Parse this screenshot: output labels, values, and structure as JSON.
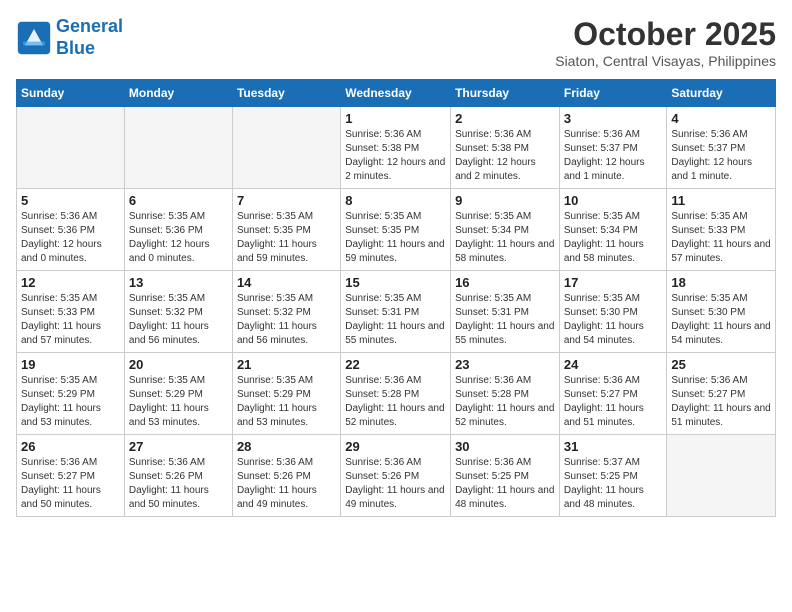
{
  "header": {
    "logo_line1": "General",
    "logo_line2": "Blue",
    "month": "October 2025",
    "location": "Siaton, Central Visayas, Philippines"
  },
  "days_of_week": [
    "Sunday",
    "Monday",
    "Tuesday",
    "Wednesday",
    "Thursday",
    "Friday",
    "Saturday"
  ],
  "weeks": [
    [
      {
        "day": "",
        "empty": true
      },
      {
        "day": "",
        "empty": true
      },
      {
        "day": "",
        "empty": true
      },
      {
        "day": "1",
        "sunrise": "5:36 AM",
        "sunset": "5:38 PM",
        "daylight": "12 hours and 2 minutes."
      },
      {
        "day": "2",
        "sunrise": "5:36 AM",
        "sunset": "5:38 PM",
        "daylight": "12 hours and 2 minutes."
      },
      {
        "day": "3",
        "sunrise": "5:36 AM",
        "sunset": "5:37 PM",
        "daylight": "12 hours and 1 minute."
      },
      {
        "day": "4",
        "sunrise": "5:36 AM",
        "sunset": "5:37 PM",
        "daylight": "12 hours and 1 minute."
      }
    ],
    [
      {
        "day": "5",
        "sunrise": "5:36 AM",
        "sunset": "5:36 PM",
        "daylight": "12 hours and 0 minutes."
      },
      {
        "day": "6",
        "sunrise": "5:35 AM",
        "sunset": "5:36 PM",
        "daylight": "12 hours and 0 minutes."
      },
      {
        "day": "7",
        "sunrise": "5:35 AM",
        "sunset": "5:35 PM",
        "daylight": "11 hours and 59 minutes."
      },
      {
        "day": "8",
        "sunrise": "5:35 AM",
        "sunset": "5:35 PM",
        "daylight": "11 hours and 59 minutes."
      },
      {
        "day": "9",
        "sunrise": "5:35 AM",
        "sunset": "5:34 PM",
        "daylight": "11 hours and 58 minutes."
      },
      {
        "day": "10",
        "sunrise": "5:35 AM",
        "sunset": "5:34 PM",
        "daylight": "11 hours and 58 minutes."
      },
      {
        "day": "11",
        "sunrise": "5:35 AM",
        "sunset": "5:33 PM",
        "daylight": "11 hours and 57 minutes."
      }
    ],
    [
      {
        "day": "12",
        "sunrise": "5:35 AM",
        "sunset": "5:33 PM",
        "daylight": "11 hours and 57 minutes."
      },
      {
        "day": "13",
        "sunrise": "5:35 AM",
        "sunset": "5:32 PM",
        "daylight": "11 hours and 56 minutes."
      },
      {
        "day": "14",
        "sunrise": "5:35 AM",
        "sunset": "5:32 PM",
        "daylight": "11 hours and 56 minutes."
      },
      {
        "day": "15",
        "sunrise": "5:35 AM",
        "sunset": "5:31 PM",
        "daylight": "11 hours and 55 minutes."
      },
      {
        "day": "16",
        "sunrise": "5:35 AM",
        "sunset": "5:31 PM",
        "daylight": "11 hours and 55 minutes."
      },
      {
        "day": "17",
        "sunrise": "5:35 AM",
        "sunset": "5:30 PM",
        "daylight": "11 hours and 54 minutes."
      },
      {
        "day": "18",
        "sunrise": "5:35 AM",
        "sunset": "5:30 PM",
        "daylight": "11 hours and 54 minutes."
      }
    ],
    [
      {
        "day": "19",
        "sunrise": "5:35 AM",
        "sunset": "5:29 PM",
        "daylight": "11 hours and 53 minutes."
      },
      {
        "day": "20",
        "sunrise": "5:35 AM",
        "sunset": "5:29 PM",
        "daylight": "11 hours and 53 minutes."
      },
      {
        "day": "21",
        "sunrise": "5:35 AM",
        "sunset": "5:29 PM",
        "daylight": "11 hours and 53 minutes."
      },
      {
        "day": "22",
        "sunrise": "5:36 AM",
        "sunset": "5:28 PM",
        "daylight": "11 hours and 52 minutes."
      },
      {
        "day": "23",
        "sunrise": "5:36 AM",
        "sunset": "5:28 PM",
        "daylight": "11 hours and 52 minutes."
      },
      {
        "day": "24",
        "sunrise": "5:36 AM",
        "sunset": "5:27 PM",
        "daylight": "11 hours and 51 minutes."
      },
      {
        "day": "25",
        "sunrise": "5:36 AM",
        "sunset": "5:27 PM",
        "daylight": "11 hours and 51 minutes."
      }
    ],
    [
      {
        "day": "26",
        "sunrise": "5:36 AM",
        "sunset": "5:27 PM",
        "daylight": "11 hours and 50 minutes."
      },
      {
        "day": "27",
        "sunrise": "5:36 AM",
        "sunset": "5:26 PM",
        "daylight": "11 hours and 50 minutes."
      },
      {
        "day": "28",
        "sunrise": "5:36 AM",
        "sunset": "5:26 PM",
        "daylight": "11 hours and 49 minutes."
      },
      {
        "day": "29",
        "sunrise": "5:36 AM",
        "sunset": "5:26 PM",
        "daylight": "11 hours and 49 minutes."
      },
      {
        "day": "30",
        "sunrise": "5:36 AM",
        "sunset": "5:25 PM",
        "daylight": "11 hours and 48 minutes."
      },
      {
        "day": "31",
        "sunrise": "5:37 AM",
        "sunset": "5:25 PM",
        "daylight": "11 hours and 48 minutes."
      },
      {
        "day": "",
        "empty": true
      }
    ]
  ],
  "labels": {
    "sunrise": "Sunrise:",
    "sunset": "Sunset:",
    "daylight": "Daylight:"
  }
}
